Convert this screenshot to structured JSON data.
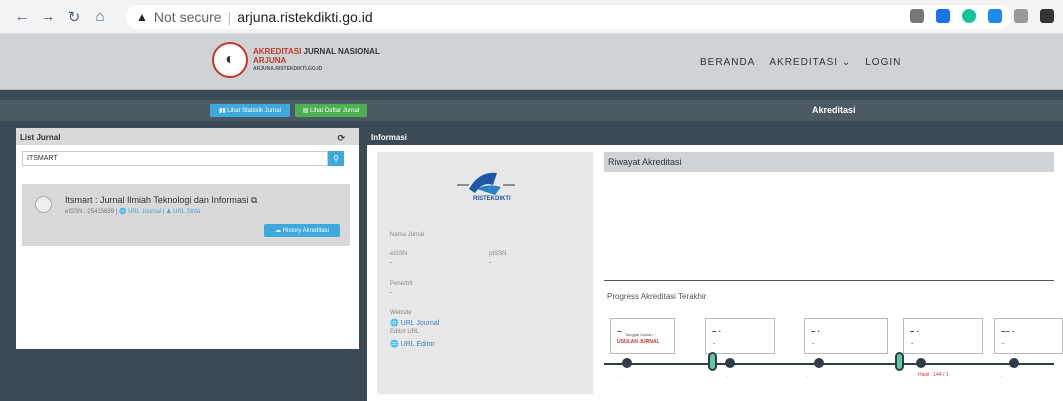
{
  "browser": {
    "url_prefix": "Not secure",
    "url": "arjuna.ristekdikti.go.id",
    "back_icon": "arrow-left-icon",
    "forward_icon": "arrow-right-icon",
    "reload_icon": "reload-icon",
    "home_icon": "home-icon"
  },
  "site": {
    "logo_line1": "AKREDITASI",
    "logo_line1b": "JURNAL NASIONAL",
    "logo_line2": "ARJUNA",
    "logo_line3": "ARJUNA.RISTEKDIKTI.GO.ID",
    "nav": {
      "beranda": "BERANDA",
      "akreditasi": "AKREDITASI ⌄",
      "login": "LOGIN"
    }
  },
  "toolbar": {
    "statistik": "▮▮ Lihat Statistik Jurnal",
    "daftar": "▤ Lihat Daftar Jurnal",
    "title": "Akreditasi"
  },
  "list_panel": {
    "title": "List Jurnal",
    "search_value": "ITSMART",
    "journal": {
      "title": "Itsmart : Jurnal Ilmiah Teknologi dan Informasi ⧉",
      "eissn": "eISSN : 25415689 |",
      "url_journal": "🌐 URL Journal",
      "url_sinta": "| ♟ URL Sinta",
      "history_button": "☁ History Akreditasi"
    }
  },
  "info_panel": {
    "title": "Informasi",
    "logo_text": "RISTEKDIKTI",
    "nama_jurnal_label": "Nama Jurnal",
    "eissn_label": "eISSN",
    "pissn_label": "pISSN",
    "eissn_value": "-",
    "pissn_value": "-",
    "penerbit_label": "Penerbit",
    "penerbit_value": "-",
    "website_label": "Website",
    "url_journal": "🌐 URL Journal",
    "editor_label": "Editor URL",
    "url_editor": "🌐 URL Editor"
  },
  "riwayat": {
    "title": "Riwayat Akreditasi",
    "progress_title": "Progress Akreditasi Terakhir",
    "steps": [
      {
        "dash": "–",
        "small": "Tanggal Usulan",
        "status": "USULAN JURNAL"
      },
      {
        "dash": "– ·",
        "dot": "-"
      },
      {
        "dash": "– ·",
        "dot": "-"
      },
      {
        "dash": "– ·",
        "dot": "-"
      },
      {
        "dash": "–– ·",
        "dot": "-"
      }
    ],
    "timeline_labels": [
      "-",
      "-",
      "-",
      "-"
    ],
    "hasil": "Hasil : 144 / 1"
  }
}
